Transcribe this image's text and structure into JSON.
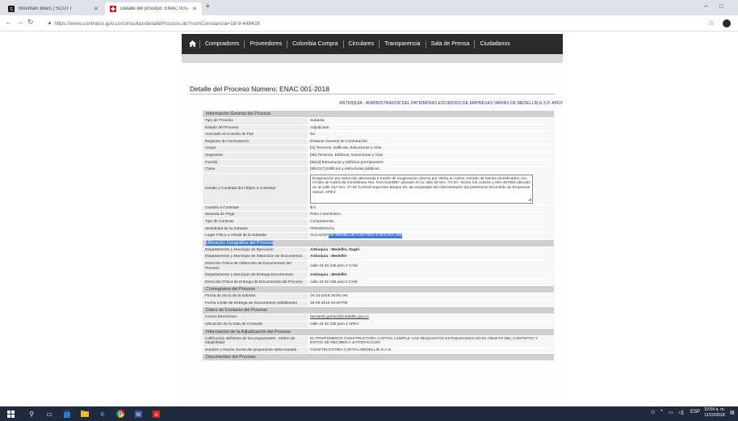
{
  "browser": {
    "tabs": [
      {
        "title": "Mountain Bikes | SCOTT",
        "favicon": "scott-icon"
      },
      {
        "title": "Detalle del proceso: ENAC 001-2",
        "favicon": "colombia-compra-icon"
      }
    ],
    "new_tab": "+",
    "url": "https://www.contratos.gov.co/consultas/detalleProceso.do?numConstancia=18-9-448426",
    "minimize": "–",
    "maximize": "□"
  },
  "site_nav": {
    "items": [
      "Compradores",
      "Proveedores",
      "Colombia Compra",
      "Circulares",
      "Transparencia",
      "Sala de Prensa",
      "Ciudadanos"
    ]
  },
  "page": {
    "title": "Detalle del Proceso Número: ENAC 001-2018",
    "entity": "ANTIOQUIA - ADMINISTRADOR DEL PATRIMONIO ESCINDIDO DE EMPRESAS VARIAS DE MEDELLÍN E.S.P. APEV"
  },
  "sections": {
    "general": "Información General del Proceso",
    "ubicacion": "Ubicación Geográfica del Proceso",
    "cronograma": "Cronograma del Proceso",
    "contacto": "Datos de Contacto del Proceso",
    "adjudicacion": "Información de la Adjudicación del Proceso",
    "documentos": "Documentos del Proceso"
  },
  "general_rows": [
    {
      "label": "Tipo de Proceso",
      "value": "Subasta"
    },
    {
      "label": "Estado del Proceso",
      "value": "Adjudicado"
    },
    {
      "label": "Asociado al Acuerdo de Paz",
      "value": "No"
    },
    {
      "label": "Régimen de Contratación",
      "value": "Estatuto General de Contratación"
    },
    {
      "label": "Grupo",
      "value": "[G] Terrenos, Edificios, Estructuras y Vías"
    },
    {
      "label": "Segmento",
      "value": "[95] Terrenos, Edificios, Estructuras y Vías"
    },
    {
      "label": "Familia",
      "value": "[9512] Estructuras y edificios permanentes"
    },
    {
      "label": "Clase",
      "value": "[951217] Edificios y estructuras públicos"
    }
  ],
  "objeto": {
    "label": "Detalle y Cantidad del Objeto a Contratar",
    "value": "Enajenación por selección abreviada a través de enajenación directa por oferta en sobre cerrado de bienes identificados con el folio de matrícula inmobiliaria Nro. 01N-5184967 ubicado en la calle 53 Nro. 73-20– sector los colores y 001-457983 ubicado en la calle 34A Nro. 47-50 Central mayorista Bloque 20, de propiedad del Administrador del patrimonio Escindido de Empresas Varias- APEV"
  },
  "general_rows_2": [
    {
      "label": "Cuantía a Contratar",
      "value": "$ 0"
    },
    {
      "label": "Moneda de Pago",
      "value": "Peso Colombiano"
    },
    {
      "label": "Tipo de Contrato",
      "value": "Compraventa"
    },
    {
      "label": "Modalidad de la Subasta",
      "value": "PRESENCIAL"
    }
  ],
  "lugar": {
    "label": "Lugar Físico o Virtual de la Subasta",
    "value_plain": "ALCALDIA ",
    "value_selected": "DE MEDELLIN CAM PISO 4 OFICINA 405"
  },
  "ubicacion_rows": [
    {
      "label": "Departamento y Municipio de Ejecución",
      "value": "Antioquia : Medellín, Itagüí"
    },
    {
      "label": "Departamento y Municipio de Obtención de Documentos",
      "value": "Antioquia : Medellín"
    },
    {
      "label": "Dirección Física de Obtención de Documentos del Proceso",
      "value": "calle 44 52 165 piso 4 CAM"
    },
    {
      "label": "Departamento y Municipio de Entrega Documentos",
      "value": "Antioquia : Medellín"
    },
    {
      "label": "Dirección Física de Entrega de Documentos del Proceso",
      "value": "calle 44 52 165 piso 4 CAM"
    }
  ],
  "cronograma_rows": [
    {
      "label": "Fecha de Inicio de la subasta",
      "value": "04-10-2018 10:00 AM"
    },
    {
      "label": "Fecha Límite de Entrega de Documentos Habilitantes",
      "value": "25-09-2018 04:00 PM"
    }
  ],
  "contacto_rows": [
    {
      "label": "Correo Electrónico",
      "value": "bernardo.gomez@medellin.gov.co"
    },
    {
      "label": "Ubicación de la Sala de Consulta",
      "value": "calle 44 52 165 piso 4 APEV"
    }
  ],
  "adjudicacion_rows": [
    {
      "label": "Calificación definitiva de los proponentes - Orden de elegibilidad",
      "value": "EL PROPONENTE CONSTRUCTORA CAPITAL CUMPLE LOS REQUISITOS ESTABLECIDOS EN EL OBJETO DEL CONTRATO Y ESTOS SE RECIBEN A SATISFACCION"
    },
    {
      "label": "Nombre o Razón Social del proponente seleccionado",
      "value": "CONSTRUCTORA CAPITAL MEDELLIN S.A.S."
    }
  ],
  "taskbar": {
    "lang": "ESP",
    "time": "10:54 a. m.",
    "date": "11/10/2018"
  }
}
